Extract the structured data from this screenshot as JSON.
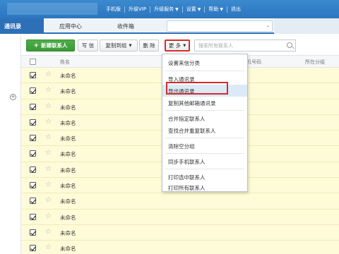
{
  "colors": {
    "brand_blue": "#2d70b8",
    "new_button_green": "#3a9a36",
    "highlight_red": "#d62b2b",
    "row_yellow": "#fefbd8",
    "menu_hover": "#dceaf7"
  },
  "top_nav": {
    "items": [
      {
        "label": "手机版",
        "has_caret": false
      },
      {
        "label": "升级VIP",
        "has_caret": false
      },
      {
        "label": "升级服务",
        "has_caret": true
      },
      {
        "label": "设置",
        "has_caret": true
      },
      {
        "label": "帮助",
        "has_caret": true
      },
      {
        "label": "退出",
        "has_caret": false
      }
    ]
  },
  "tabs": {
    "contacts": "通讯录",
    "app_center": "应用中心",
    "inbox": "收件箱"
  },
  "toolbar": {
    "new_contact": "新建联系人",
    "write_letter": "写 信",
    "copy_to_group": "复制到组",
    "delete": "删 除",
    "more": "更 多",
    "search_placeholder": "搜索所有联系人"
  },
  "table": {
    "headers": {
      "name": "姓名",
      "phone": "手机号码",
      "group": "所在分组"
    },
    "rows": [
      {
        "name": "未命名",
        "checked": true
      },
      {
        "name": "未命名",
        "checked": true
      },
      {
        "name": "未命名",
        "checked": true
      },
      {
        "name": "未命名",
        "checked": true
      },
      {
        "name": "未命名",
        "checked": true
      },
      {
        "name": "未命名",
        "checked": true
      },
      {
        "name": "未命名",
        "checked": true
      },
      {
        "name": "未命名",
        "checked": true
      },
      {
        "name": "未命名",
        "checked": true
      },
      {
        "name": "未命名",
        "checked": true
      },
      {
        "name": "未命名",
        "checked": true
      },
      {
        "name": "未命名",
        "checked": true
      }
    ]
  },
  "more_menu": {
    "items": [
      "设置来信分类",
      "导入通讯录",
      "导出通讯录",
      "复制其他邮箱通讯录",
      "合并指定联系人",
      "查找合并重复联系人",
      "清除空分组",
      "同步手机联系人",
      "打印选中联系人",
      "打印所有联系人"
    ],
    "highlighted": "导出通讯录"
  }
}
